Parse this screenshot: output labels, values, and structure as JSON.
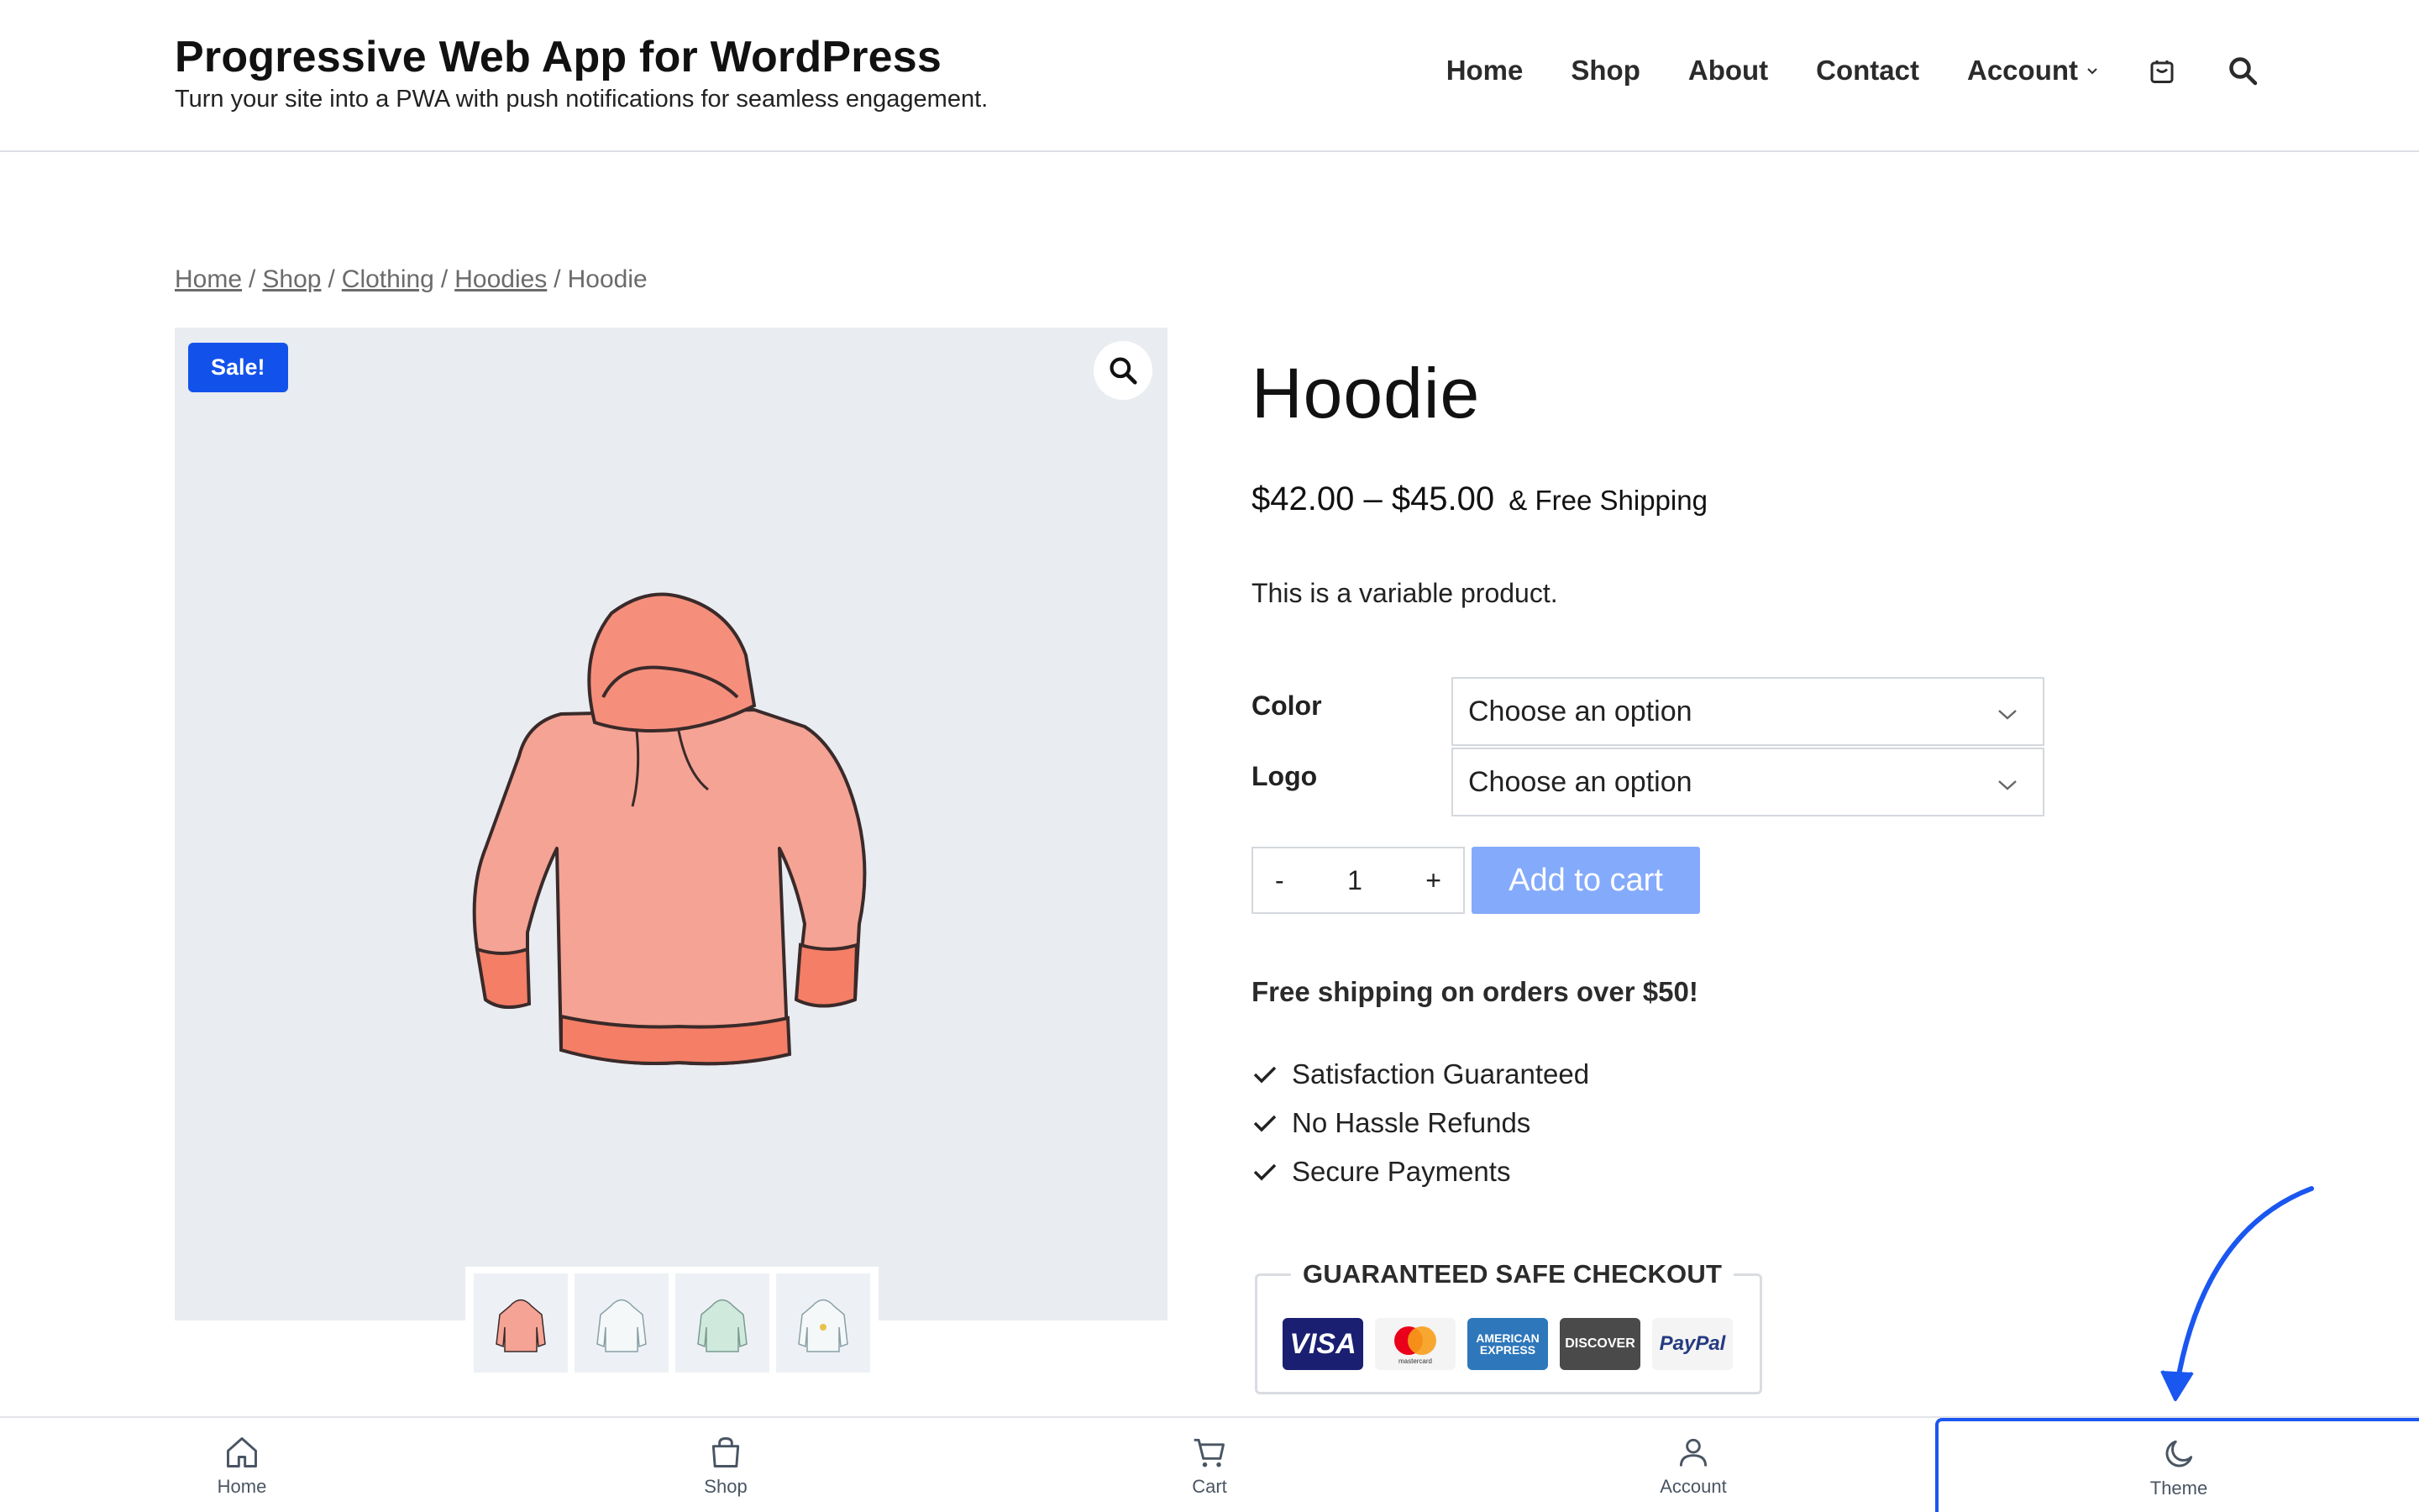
{
  "header": {
    "title": "Progressive Web App for WordPress",
    "tagline": "Turn your site into a PWA with push notifications for seamless engagement.",
    "nav": [
      {
        "label": "Home"
      },
      {
        "label": "Shop"
      },
      {
        "label": "About"
      },
      {
        "label": "Contact"
      },
      {
        "label": "Account"
      }
    ],
    "icons": [
      "cart-icon",
      "search-icon"
    ]
  },
  "breadcrumb": [
    "Home",
    "Shop",
    "Clothing",
    "Hoodies",
    "Hoodie"
  ],
  "gallery": {
    "badge": "Sale!",
    "zoom_icon": "🔍",
    "thumbnails": 4
  },
  "product": {
    "title": "Hoodie",
    "price": "$42.00 – $45.00",
    "shipping_note": "& Free Shipping",
    "short_description": "This is a variable product.",
    "variations": [
      {
        "label": "Color",
        "value": "Choose an option"
      },
      {
        "label": "Logo",
        "value": "Choose an option"
      }
    ],
    "quantity": "1",
    "qty_minus": "-",
    "qty_plus": "+",
    "add_to_cart": "Add to cart",
    "free_shipping": "Free shipping on orders over $50!",
    "benefits": [
      "Satisfaction Guaranteed",
      "No Hassle Refunds",
      "Secure Payments"
    ],
    "safe_checkout_title": "GUARANTEED SAFE CHECKOUT",
    "payment_cards": [
      "VISA",
      "mastercard",
      "AMERICAN EXPRESS",
      "DISCOVER",
      "PayPal"
    ]
  },
  "bottom_nav": [
    {
      "label": "Home",
      "icon": "home-icon"
    },
    {
      "label": "Shop",
      "icon": "bag-icon"
    },
    {
      "label": "Cart",
      "icon": "cart-icon"
    },
    {
      "label": "Account",
      "icon": "user-icon"
    },
    {
      "label": "Theme",
      "icon": "moon-icon"
    }
  ],
  "colors": {
    "accent": "#1352ea",
    "add_to_cart_bg": "#84aafc",
    "gallery_bg": "#e9ecf1",
    "hoodie": "#f4a190"
  }
}
